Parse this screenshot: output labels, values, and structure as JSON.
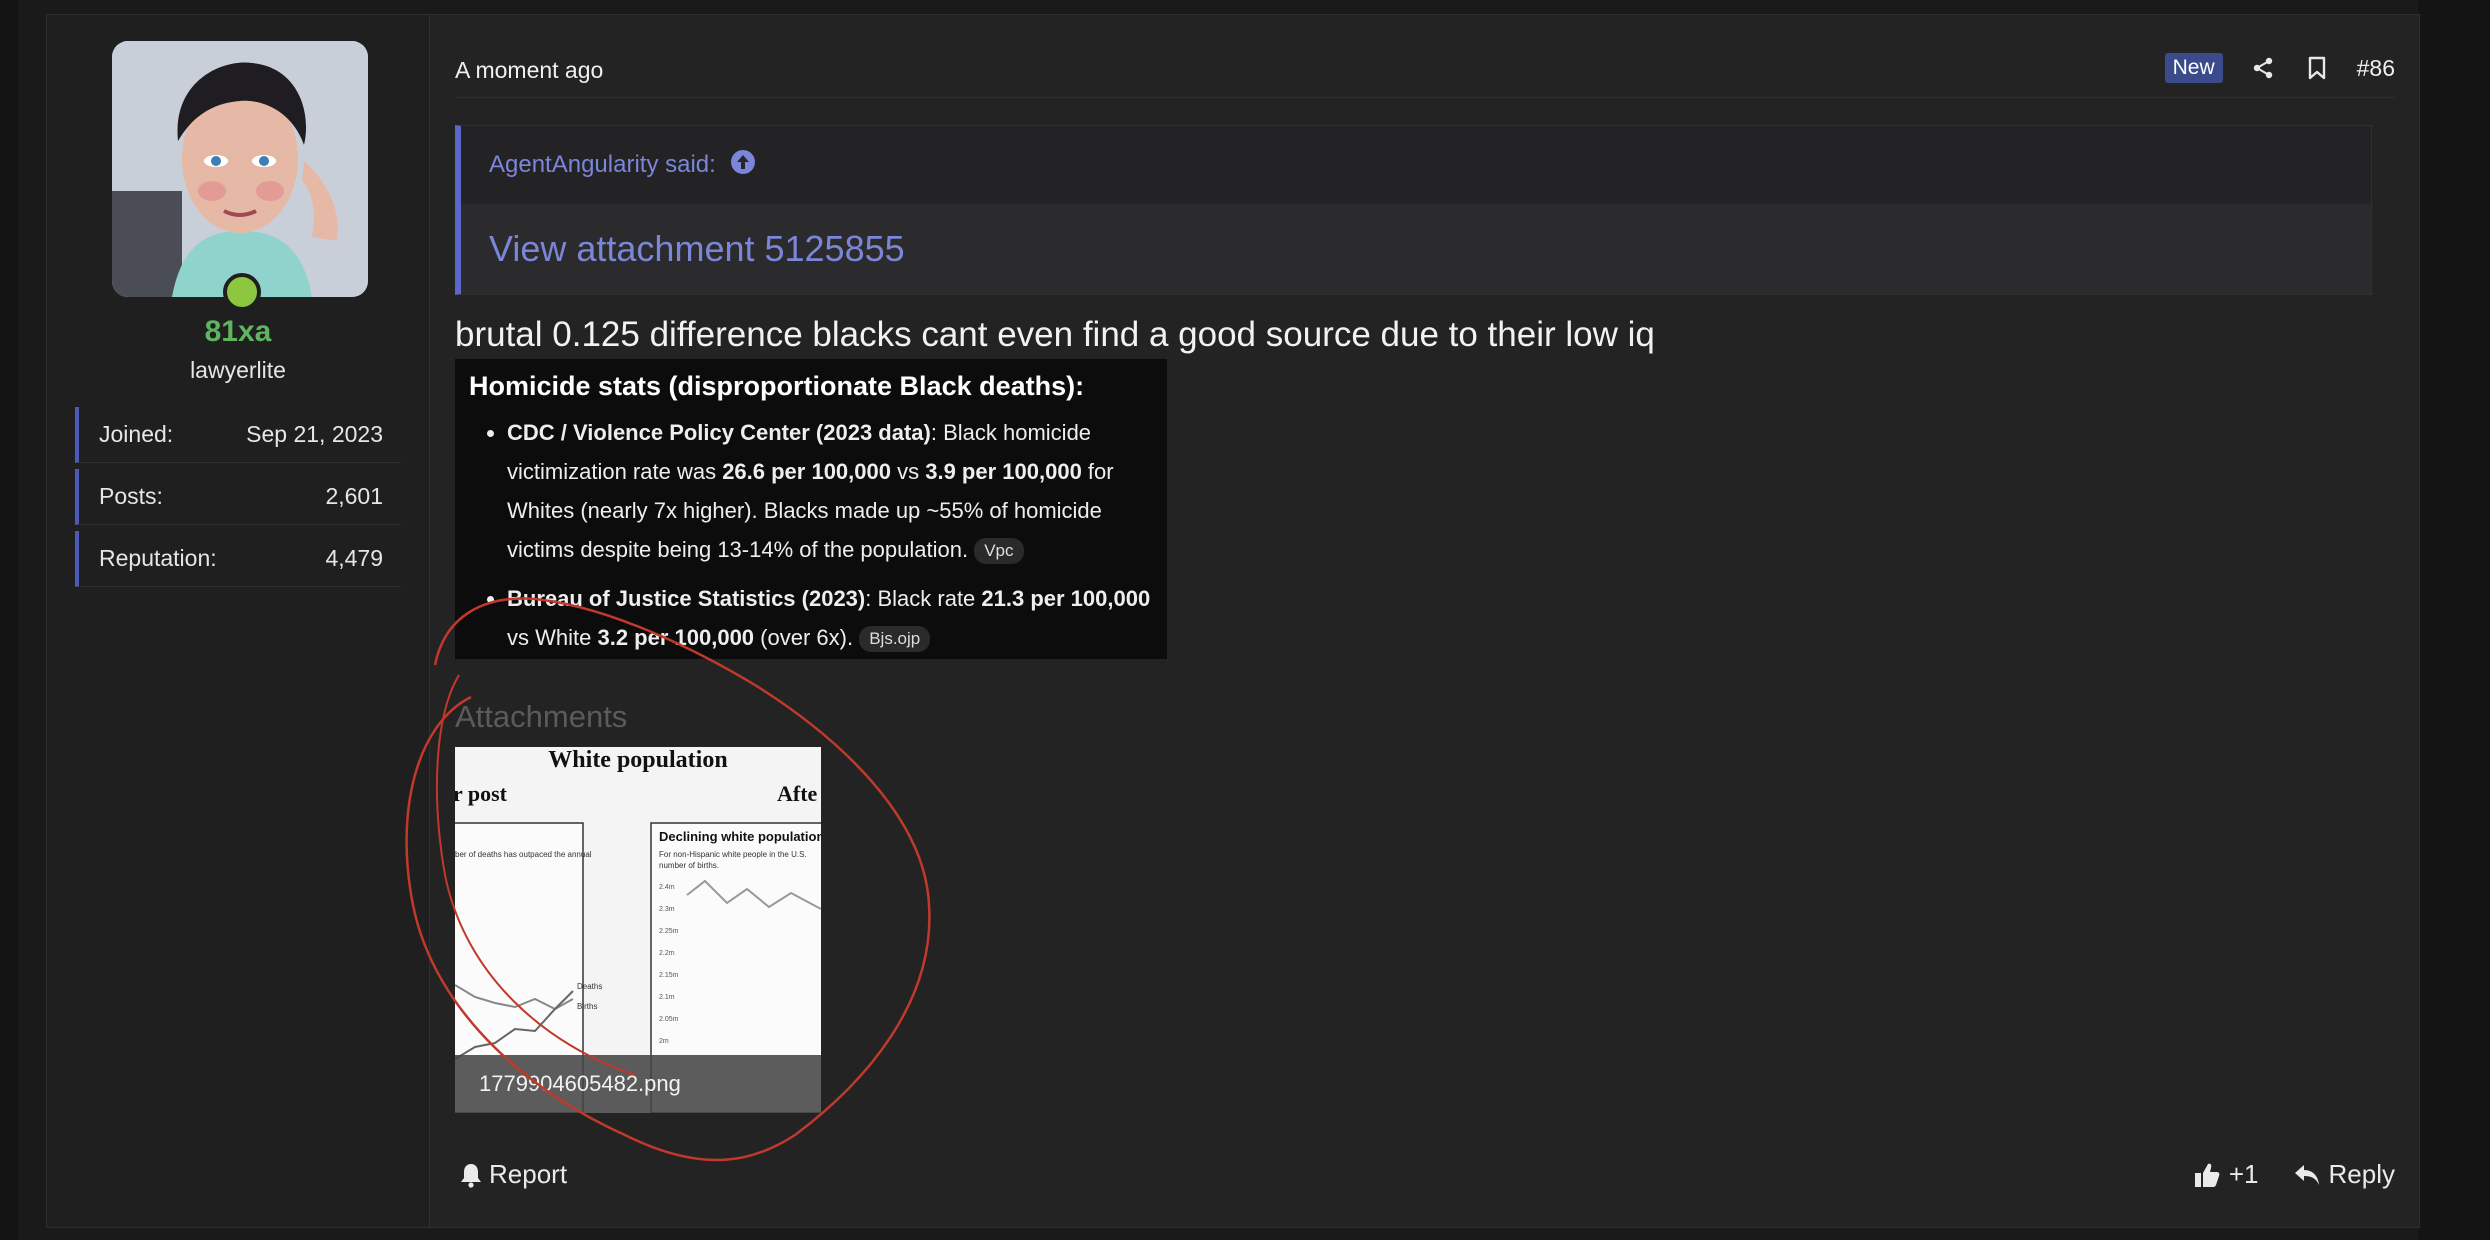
{
  "user": {
    "username": "81xa",
    "title": "lawyerlite",
    "stats": [
      {
        "label": "Joined:",
        "value": "Sep 21, 2023"
      },
      {
        "label": "Posts:",
        "value": "2,601"
      },
      {
        "label": "Reputation:",
        "value": "4,479"
      }
    ],
    "online_color": "#8dc63f"
  },
  "post": {
    "time": "A moment ago",
    "badge": "New",
    "number": "#86",
    "quote_author": "AgentAngularity said:",
    "quote_link": "View attachment 5125855",
    "text": "brutal 0.125 difference blacks cant even find a good source due to their low iq"
  },
  "embed": {
    "heading": "Homicide stats (disproportionate Black deaths):",
    "items": [
      {
        "bold1": "CDC / Violence Policy Center (2023 data)",
        "t1": ": Black homicide victimization rate was ",
        "bold2": "26.6 per 100,000",
        "t2": " vs ",
        "bold3": "3.9 per 100,000",
        "t3": " for Whites (nearly 7x higher). Blacks made up ~55% of homicide victims despite being 13-14% of the population.",
        "source": "Vpc"
      },
      {
        "bold1": "Bureau of Justice Statistics (2023)",
        "t1": ": Black rate ",
        "bold2": "21.3 per 100,000",
        "t2": " vs White ",
        "bold3": "3.2 per 100,000",
        "t3": " (over 6x).",
        "source": "Bjs.ojp"
      }
    ]
  },
  "attachments": {
    "title": "Attachments",
    "file_name": "1779904605482.png",
    "thumb_title": "White population",
    "thumb_left_heading": "r post",
    "thumb_right_heading": "Afte",
    "thumb_left_caption": "ber of deaths has outpaced the annual",
    "thumb_right_title": "Declining white population",
    "thumb_right_caption": "For non-Hispanic white people in the U.S.",
    "thumb_right_caption2": "number of births.",
    "thumb_series_a": "Deaths",
    "thumb_series_b": "Births",
    "thumb_ticks": [
      "2.4m",
      "2.3m",
      "2.25m",
      "2.2m",
      "2.15m",
      "2.1m",
      "2.05m",
      "2m"
    ]
  },
  "footer": {
    "report": "Report",
    "like_count": "+1",
    "reply": "Reply"
  },
  "colors": {
    "accent": "#5c68c9",
    "username": "#5fb55f",
    "annotation": "#c0392b"
  }
}
